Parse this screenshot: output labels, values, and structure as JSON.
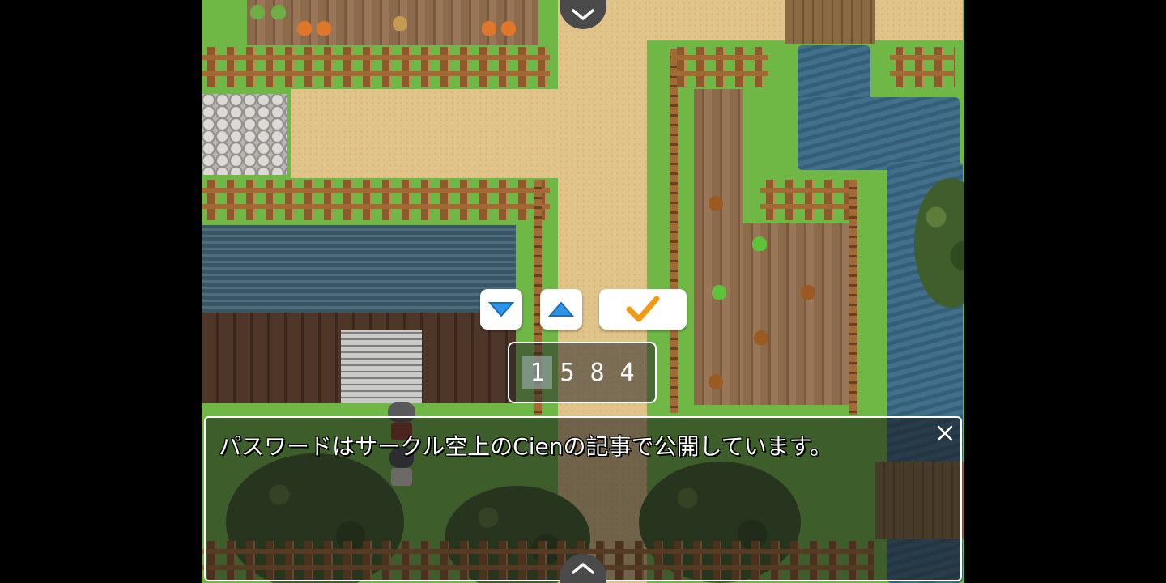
{
  "game": {
    "message_text": "パスワードはサークル空上のCienの記事で公開しています。",
    "password_digits": [
      "1",
      "5",
      "8",
      "4"
    ],
    "selected_digit_index": 0
  },
  "controls": {
    "scroll_up_icon": "chevron-down-icon",
    "scroll_down_icon": "chevron-up-icon",
    "decrement_icon": "triangle-down-icon",
    "increment_icon": "triangle-up-icon",
    "confirm_icon": "checkmark-icon",
    "close_icon": "close-icon"
  },
  "colors": {
    "button_triangle": "#2f95e8",
    "confirm_check": "#f39a12",
    "window_border": "#ffffff"
  }
}
